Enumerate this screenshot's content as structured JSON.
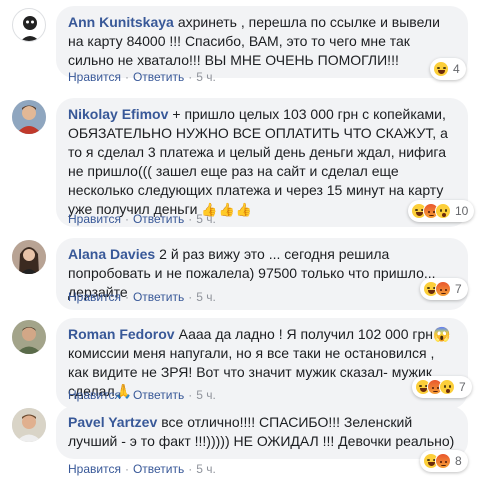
{
  "comments": [
    {
      "author": "Ann Kunitskaya",
      "text": "ахринеть , перешла по ссылке и вывели на карту 84000 !!! Спасибо, ВАМ, это то чего мне так сильно не хватало!!! ВЫ МНЕ ОЧЕНЬ ПОМОГЛИ!!!",
      "like": "Нравится",
      "reply": "Ответить",
      "time": "5 ч.",
      "reactions": [
        "laugh"
      ],
      "reaction_count": "4"
    },
    {
      "author": "Nikolay Efimov",
      "text": "+ пришло целых 103 000 грн с копейками, ОБЯЗАТЕЛЬНО НУЖНО ВСЕ ОПЛАТИТЬ ЧТО СКАЖУТ, а то я сделал 3 платежа и целый день деньги ждал, нифига не пришло((( зашел еще раз на сайт и сделал еще несколько следующих платежа и через 15 минут на карту уже получил деньги",
      "thumbs": "👍👍👍",
      "like": "Нравится",
      "reply": "Ответить",
      "time": "5 ч.",
      "reactions": [
        "laugh",
        "angry",
        "wow"
      ],
      "reaction_count": "10"
    },
    {
      "author": "Alana Davies",
      "text": "2 й раз вижу это ... сегодня решила попробовать и не пожалела) 97500 только что пришло... дерзайте",
      "like": "Нравится",
      "reply": "Ответить",
      "time": "5 ч.",
      "reactions": [
        "laugh",
        "angry"
      ],
      "reaction_count": "7"
    },
    {
      "author": "Roman Fedorov",
      "text": "Аааа да ладно ! Я получил 102 000 грн😱 комиссии меня напугали, но я все таки не остановился , как видите не ЗРЯ! Вот что значит мужик сказал- мужик сделал🙏",
      "like": "Нравится",
      "reply": "Ответить",
      "time": "5 ч.",
      "reactions": [
        "laugh",
        "angry",
        "wow"
      ],
      "reaction_count": "7"
    },
    {
      "author": "Pavel Yartzev",
      "text": "все отлично!!!! СПАСИБО!!! Зеленский лучший - э то факт !!!))))) НЕ ОЖИДАЛ !!! Девочки реально)",
      "like": "Нравится",
      "reply": "Ответить",
      "time": "5 ч.",
      "reactions": [
        "laugh",
        "angry"
      ],
      "reaction_count": "8"
    }
  ]
}
